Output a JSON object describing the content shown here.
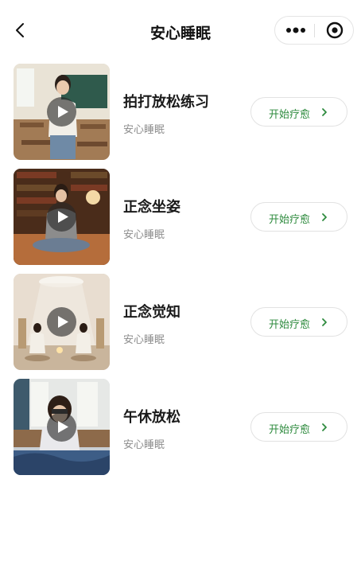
{
  "nav": {
    "title": "安心睡眠",
    "back_icon": "chevron-left-icon",
    "more_icon": "more-dots-icon",
    "close_icon": "target-circle-icon"
  },
  "items": [
    {
      "title": "拍打放松练习",
      "subtitle": "安心睡眠",
      "button": "开始疗愈"
    },
    {
      "title": "正念坐姿",
      "subtitle": "安心睡眠",
      "button": "开始疗愈"
    },
    {
      "title": "正念觉知",
      "subtitle": "安心睡眠",
      "button": "开始疗愈"
    },
    {
      "title": "午休放松",
      "subtitle": "安心睡眠",
      "button": "开始疗愈"
    }
  ],
  "colors": {
    "accent_green": "#2e8b3e",
    "title_text": "#1a1a1a",
    "subtitle_text": "#8c8c8c",
    "background": "#ffffff"
  }
}
